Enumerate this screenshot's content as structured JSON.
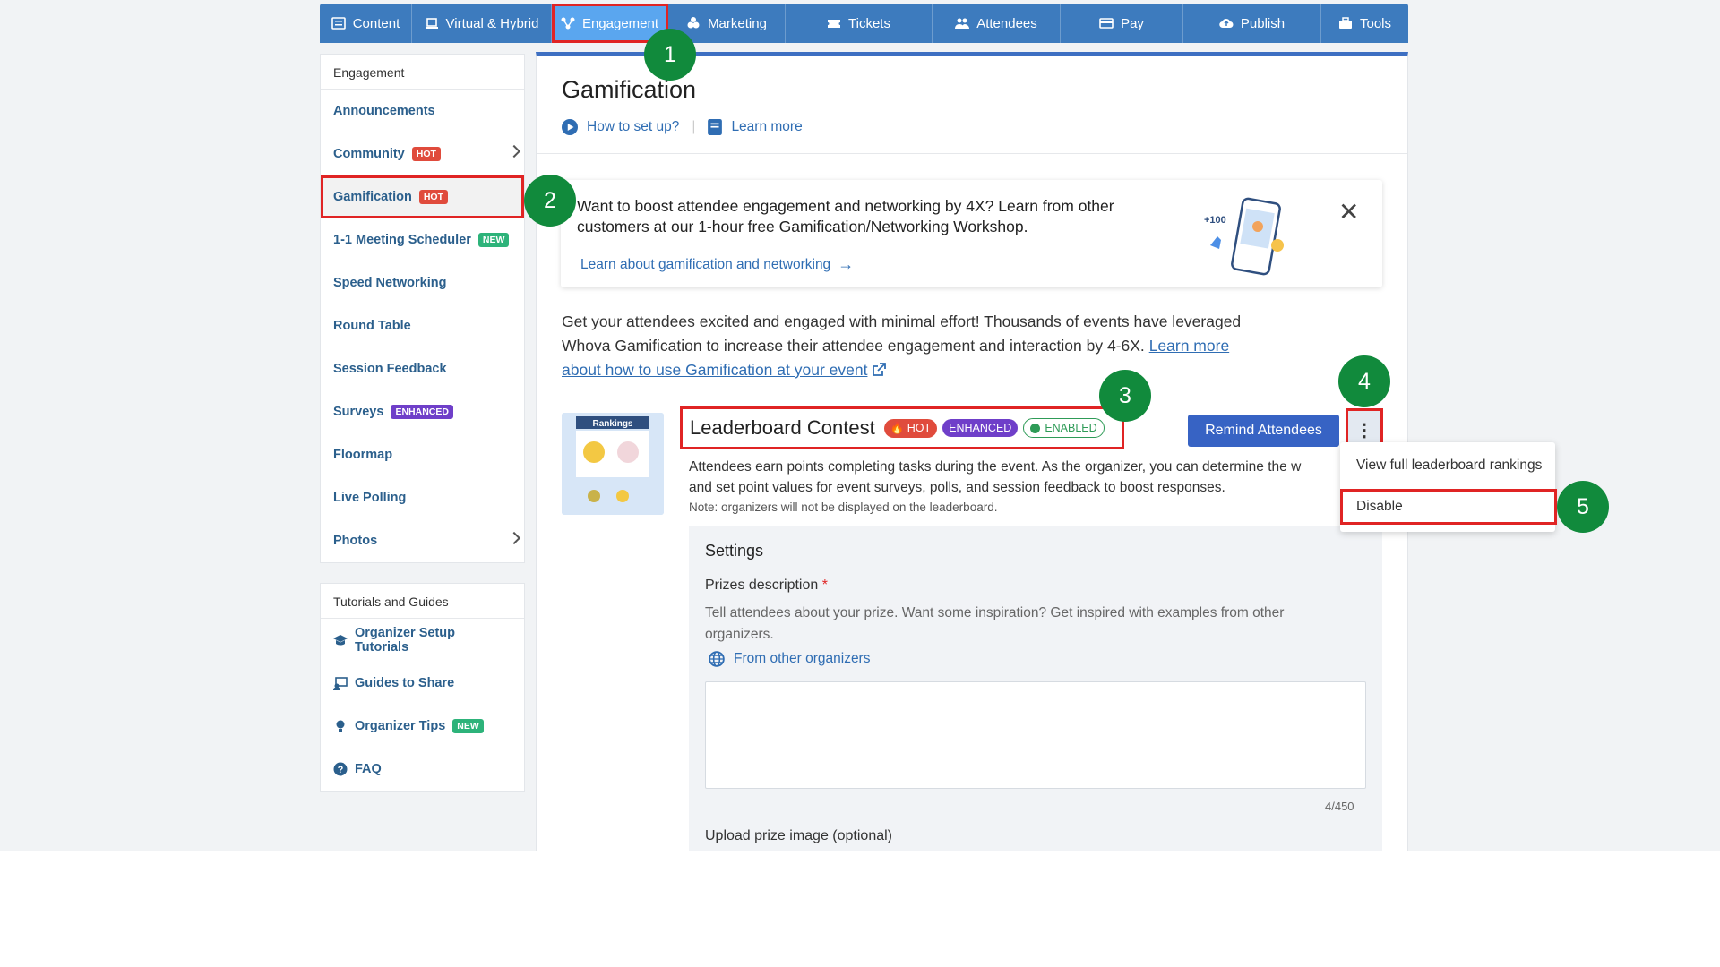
{
  "nav": {
    "tabs": [
      {
        "label": "Content",
        "icon": "content-icon"
      },
      {
        "label": "Virtual & Hybrid",
        "icon": "laptop-icon"
      },
      {
        "label": "Engagement",
        "icon": "engagement-icon",
        "active": true
      },
      {
        "label": "Marketing",
        "icon": "marketing-icon"
      },
      {
        "label": "Tickets",
        "icon": "ticket-icon"
      },
      {
        "label": "Attendees",
        "icon": "attendees-icon"
      },
      {
        "label": "Pay",
        "icon": "pay-icon"
      },
      {
        "label": "Publish",
        "icon": "cloud-upload-icon"
      },
      {
        "label": "Tools",
        "icon": "toolbox-icon"
      }
    ]
  },
  "sidebar": {
    "engagement_title": "Engagement",
    "items": [
      {
        "label": "Announcements"
      },
      {
        "label": "Community",
        "badge": "HOT",
        "badge_type": "hot",
        "chevron": true
      },
      {
        "label": "Gamification",
        "badge": "HOT",
        "badge_type": "hot",
        "selected": true
      },
      {
        "label": "1-1 Meeting Scheduler",
        "badge": "NEW",
        "badge_type": "new"
      },
      {
        "label": "Speed Networking"
      },
      {
        "label": "Round Table"
      },
      {
        "label": "Session Feedback"
      },
      {
        "label": "Surveys",
        "badge": "ENHANCED",
        "badge_type": "enh"
      },
      {
        "label": "Floormap"
      },
      {
        "label": "Live Polling"
      },
      {
        "label": "Photos",
        "chevron": true
      }
    ],
    "tutorials_title": "Tutorials and Guides",
    "tutorials": [
      {
        "label": "Organizer Setup Tutorials",
        "icon": "graduation-cap-icon"
      },
      {
        "label": "Guides to Share",
        "icon": "share-guide-icon"
      },
      {
        "label": "Organizer Tips",
        "icon": "lightbulb-icon",
        "badge": "NEW",
        "badge_type": "new"
      },
      {
        "label": "FAQ",
        "icon": "question-circle-icon"
      }
    ]
  },
  "main": {
    "title": "Gamification",
    "how_to_label": "How to set up?",
    "learn_more_label": "Learn more",
    "promo": {
      "text": "Want to boost attendee engagement and networking by 4X? Learn from other customers at our 1-hour free Gamification/Networking Workshop.",
      "link": "Learn about gamification and networking",
      "art_text": "+100",
      "close": "✕"
    },
    "description": "Get your attendees excited and engaged with minimal effort! Thousands of events have leveraged Whova Gamification to increase their attendee engagement and interaction by 4-6X.",
    "description_link": "Learn more about how to use Gamification at your event",
    "leaderboard": {
      "thumb_label": "Rankings",
      "title": "Leaderboard Contest",
      "hot": "HOT",
      "enhanced": "ENHANCED",
      "enabled": "ENABLED",
      "remind_button": "Remind Attendees",
      "more_button": "⋮",
      "description": "Attendees earn points completing tasks during the event. As the organizer, you can determine the w",
      "description2": "and set point values for event surveys, polls, and session feedback to boost responses.",
      "note": "Note: organizers will not be displayed on the leaderboard."
    },
    "settings": {
      "title": "Settings",
      "prize_label": "Prizes description",
      "required_mark": "*",
      "prize_help": "Tell attendees about your prize. Want some inspiration? Get inspired with examples from other organizers.",
      "from_other": "From other organizers",
      "counter": "4/450",
      "upload_label": "Upload prize image (optional)"
    }
  },
  "dropdown": {
    "items": [
      "View full leaderboard rankings",
      "Disable"
    ]
  },
  "steps": [
    "1",
    "2",
    "3",
    "4",
    "5"
  ],
  "colors": {
    "nav": "#3d7bbe",
    "highlight": "#e02424",
    "step": "#118a3c",
    "link": "#2f6db3"
  }
}
